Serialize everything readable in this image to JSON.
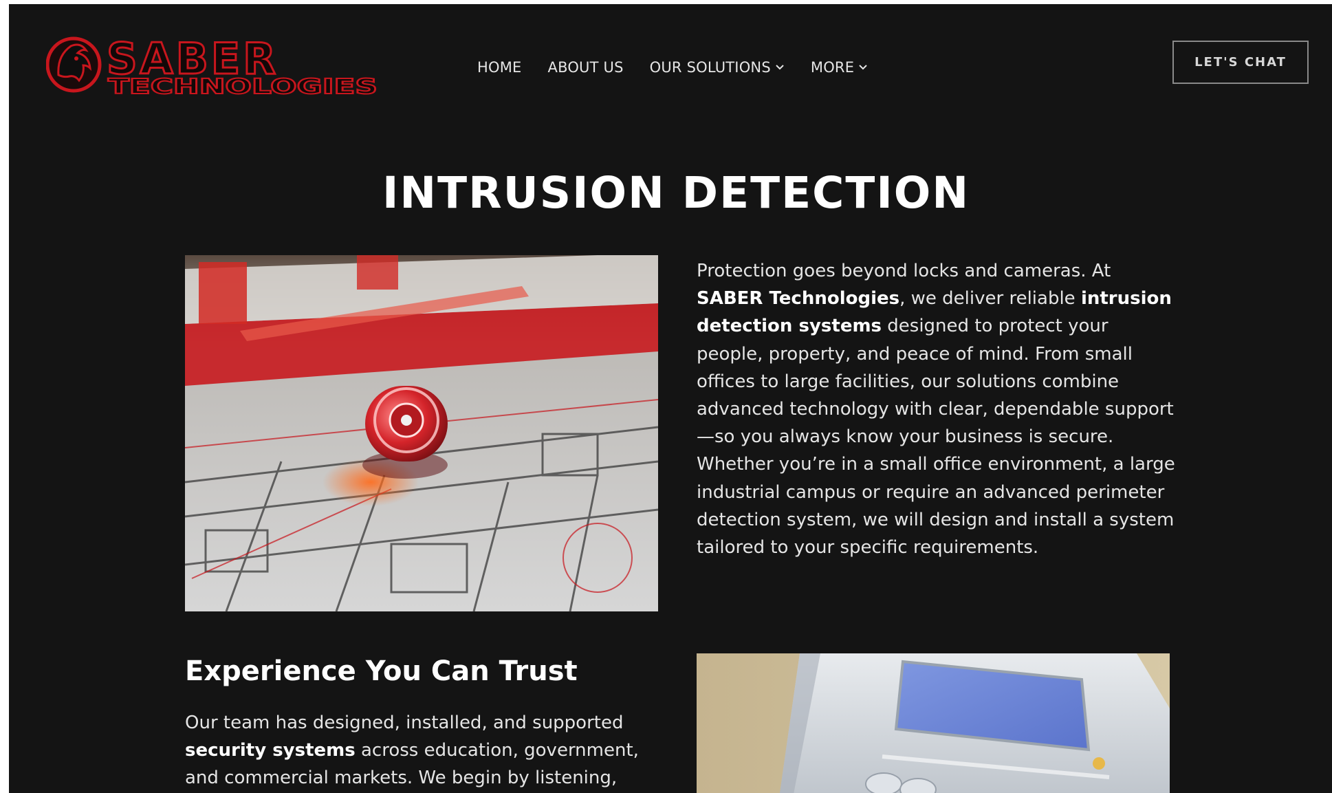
{
  "header": {
    "logo_alt": "SABER TECHNOLOGIES",
    "logo_line1": "SABER",
    "logo_line2": "TECHNOLOGIES",
    "nav": [
      {
        "label": "HOME"
      },
      {
        "label": "ABOUT US"
      },
      {
        "label": "OUR SOLUTIONS",
        "has_dropdown": true
      },
      {
        "label": "MORE",
        "has_dropdown": true
      }
    ],
    "cta_label": "LET'S CHAT"
  },
  "page": {
    "title": "INTRUSION DETECTION",
    "intro": {
      "t1": "Protection goes beyond locks and cameras. At ",
      "b1": "SABER Technologies",
      "t2": ", we deliver reliable ",
      "b2": "intrusion detection systems",
      "t3": " designed to protect your people, property, and peace of mind. From small offices to large facilities, our solutions combine advanced technology with clear, dependable support—so you always know your business is secure.",
      "p2": "Whether you’re in a small office environment, a large industrial campus or require an advanced perimeter detection system, we will design and install a system tailored to your specific requirements."
    },
    "section2": {
      "heading": "Experience You Can Trust",
      "t1": "Our team has designed, installed, and supported ",
      "b1": "security systems",
      "t2": " across education, government, and commercial markets. We begin by listening,"
    }
  },
  "colors": {
    "background": "#141414",
    "brand_red": "#c8161d",
    "text": "#e5e5e5"
  },
  "icons": {
    "dropdown": "chevron-down-icon",
    "logo_mark": "panther-head-icon"
  }
}
